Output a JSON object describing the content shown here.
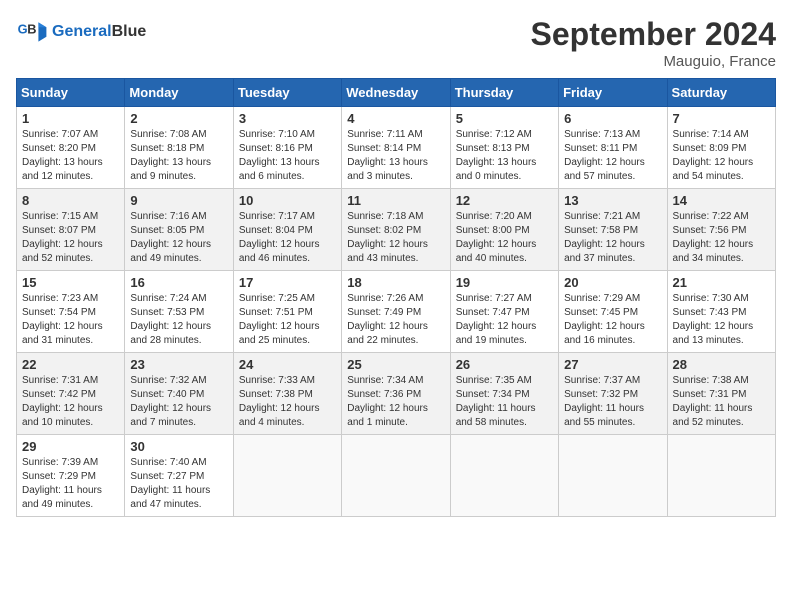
{
  "header": {
    "logo_line1": "General",
    "logo_line2": "Blue",
    "month": "September 2024",
    "location": "Mauguio, France"
  },
  "days_of_week": [
    "Sunday",
    "Monday",
    "Tuesday",
    "Wednesday",
    "Thursday",
    "Friday",
    "Saturday"
  ],
  "weeks": [
    [
      {
        "day": "1",
        "info": "Sunrise: 7:07 AM\nSunset: 8:20 PM\nDaylight: 13 hours and 12 minutes."
      },
      {
        "day": "2",
        "info": "Sunrise: 7:08 AM\nSunset: 8:18 PM\nDaylight: 13 hours and 9 minutes."
      },
      {
        "day": "3",
        "info": "Sunrise: 7:10 AM\nSunset: 8:16 PM\nDaylight: 13 hours and 6 minutes."
      },
      {
        "day": "4",
        "info": "Sunrise: 7:11 AM\nSunset: 8:14 PM\nDaylight: 13 hours and 3 minutes."
      },
      {
        "day": "5",
        "info": "Sunrise: 7:12 AM\nSunset: 8:13 PM\nDaylight: 13 hours and 0 minutes."
      },
      {
        "day": "6",
        "info": "Sunrise: 7:13 AM\nSunset: 8:11 PM\nDaylight: 12 hours and 57 minutes."
      },
      {
        "day": "7",
        "info": "Sunrise: 7:14 AM\nSunset: 8:09 PM\nDaylight: 12 hours and 54 minutes."
      }
    ],
    [
      {
        "day": "8",
        "info": "Sunrise: 7:15 AM\nSunset: 8:07 PM\nDaylight: 12 hours and 52 minutes."
      },
      {
        "day": "9",
        "info": "Sunrise: 7:16 AM\nSunset: 8:05 PM\nDaylight: 12 hours and 49 minutes."
      },
      {
        "day": "10",
        "info": "Sunrise: 7:17 AM\nSunset: 8:04 PM\nDaylight: 12 hours and 46 minutes."
      },
      {
        "day": "11",
        "info": "Sunrise: 7:18 AM\nSunset: 8:02 PM\nDaylight: 12 hours and 43 minutes."
      },
      {
        "day": "12",
        "info": "Sunrise: 7:20 AM\nSunset: 8:00 PM\nDaylight: 12 hours and 40 minutes."
      },
      {
        "day": "13",
        "info": "Sunrise: 7:21 AM\nSunset: 7:58 PM\nDaylight: 12 hours and 37 minutes."
      },
      {
        "day": "14",
        "info": "Sunrise: 7:22 AM\nSunset: 7:56 PM\nDaylight: 12 hours and 34 minutes."
      }
    ],
    [
      {
        "day": "15",
        "info": "Sunrise: 7:23 AM\nSunset: 7:54 PM\nDaylight: 12 hours and 31 minutes."
      },
      {
        "day": "16",
        "info": "Sunrise: 7:24 AM\nSunset: 7:53 PM\nDaylight: 12 hours and 28 minutes."
      },
      {
        "day": "17",
        "info": "Sunrise: 7:25 AM\nSunset: 7:51 PM\nDaylight: 12 hours and 25 minutes."
      },
      {
        "day": "18",
        "info": "Sunrise: 7:26 AM\nSunset: 7:49 PM\nDaylight: 12 hours and 22 minutes."
      },
      {
        "day": "19",
        "info": "Sunrise: 7:27 AM\nSunset: 7:47 PM\nDaylight: 12 hours and 19 minutes."
      },
      {
        "day": "20",
        "info": "Sunrise: 7:29 AM\nSunset: 7:45 PM\nDaylight: 12 hours and 16 minutes."
      },
      {
        "day": "21",
        "info": "Sunrise: 7:30 AM\nSunset: 7:43 PM\nDaylight: 12 hours and 13 minutes."
      }
    ],
    [
      {
        "day": "22",
        "info": "Sunrise: 7:31 AM\nSunset: 7:42 PM\nDaylight: 12 hours and 10 minutes."
      },
      {
        "day": "23",
        "info": "Sunrise: 7:32 AM\nSunset: 7:40 PM\nDaylight: 12 hours and 7 minutes."
      },
      {
        "day": "24",
        "info": "Sunrise: 7:33 AM\nSunset: 7:38 PM\nDaylight: 12 hours and 4 minutes."
      },
      {
        "day": "25",
        "info": "Sunrise: 7:34 AM\nSunset: 7:36 PM\nDaylight: 12 hours and 1 minute."
      },
      {
        "day": "26",
        "info": "Sunrise: 7:35 AM\nSunset: 7:34 PM\nDaylight: 11 hours and 58 minutes."
      },
      {
        "day": "27",
        "info": "Sunrise: 7:37 AM\nSunset: 7:32 PM\nDaylight: 11 hours and 55 minutes."
      },
      {
        "day": "28",
        "info": "Sunrise: 7:38 AM\nSunset: 7:31 PM\nDaylight: 11 hours and 52 minutes."
      }
    ],
    [
      {
        "day": "29",
        "info": "Sunrise: 7:39 AM\nSunset: 7:29 PM\nDaylight: 11 hours and 49 minutes."
      },
      {
        "day": "30",
        "info": "Sunrise: 7:40 AM\nSunset: 7:27 PM\nDaylight: 11 hours and 47 minutes."
      },
      {
        "day": "",
        "info": ""
      },
      {
        "day": "",
        "info": ""
      },
      {
        "day": "",
        "info": ""
      },
      {
        "day": "",
        "info": ""
      },
      {
        "day": "",
        "info": ""
      }
    ]
  ]
}
